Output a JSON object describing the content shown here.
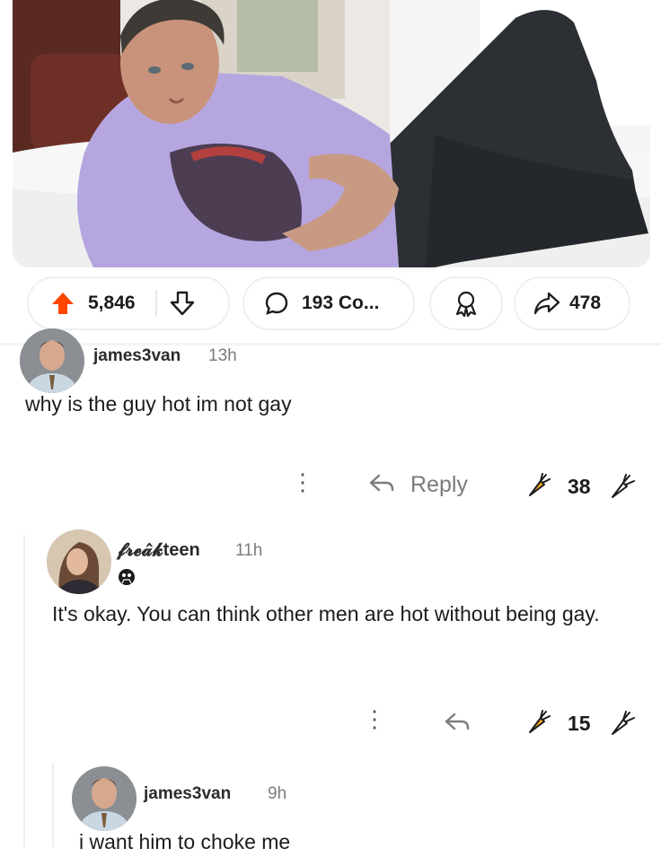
{
  "post": {
    "image_alt": "Man in lavender graphic t-shirt lying on a bed",
    "upvotes": "5,846",
    "comments": "193 Co...",
    "shares": "478"
  },
  "comments": [
    {
      "username": "james3van",
      "age": "13h",
      "text": "why is the guy hot im not gay",
      "reply_label": "Reply",
      "votes": "38"
    },
    {
      "username": "𝓯𝓻𝓮𝓪̂𝓴teen",
      "age": "11h",
      "text": "It's okay. You can think other men are hot without being gay.",
      "votes": "15"
    },
    {
      "username": "james3van",
      "age": "9h",
      "text": "i want him to choke me"
    }
  ],
  "icons": {
    "upvote": "arrow-up-icon",
    "downvote": "arrow-down-icon",
    "comment": "speech-bubble-icon",
    "award": "award-icon",
    "share": "share-arrow-icon",
    "reply": "reply-arrow-icon",
    "more": "more-dots-icon",
    "vote_up": "carrot-up-icon",
    "vote_down": "carrot-down-icon"
  },
  "colors": {
    "upvote_active": "#ff4500",
    "text": "#1c1c1c",
    "meta": "#7c7c7c"
  }
}
